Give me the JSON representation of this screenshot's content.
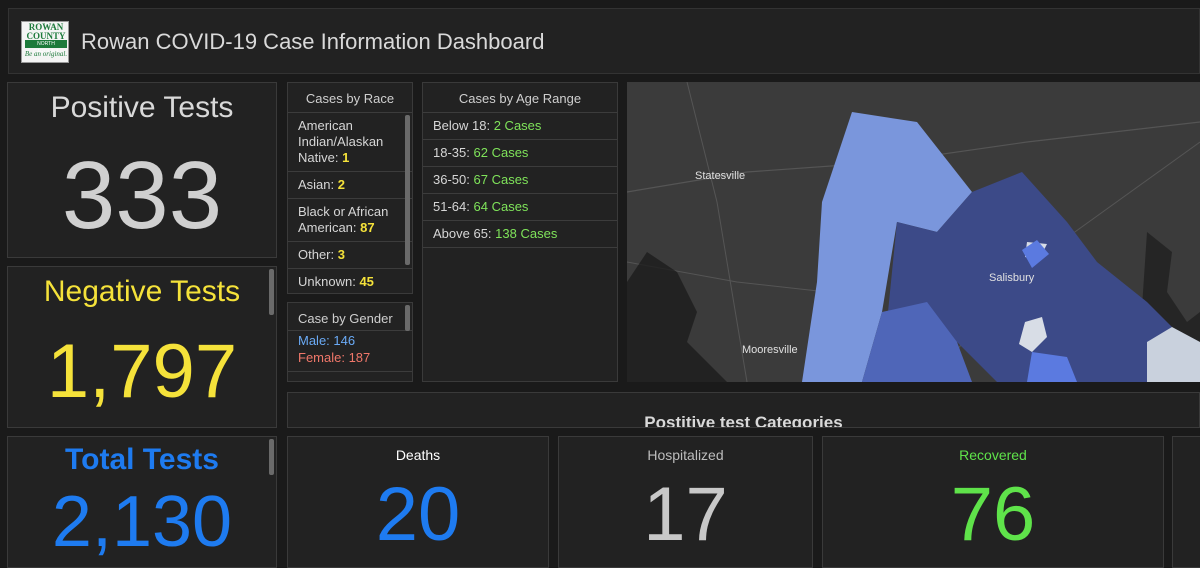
{
  "header": {
    "logo_top": "ROWAN COUNTY",
    "logo_mid": "NORTH CAROLINA",
    "logo_tagline": "Be an original.",
    "title": "Rowan COVID-19 Case Information Dashboard"
  },
  "positive": {
    "label": "Positive Tests",
    "value": "333"
  },
  "negative": {
    "label": "Negative Tests",
    "value": "1,797"
  },
  "total": {
    "label": "Total Tests",
    "value": "2,130"
  },
  "race": {
    "title": "Cases by Race",
    "items": [
      {
        "label": "American Indian/Alaskan Native:",
        "value": "1"
      },
      {
        "label": "Asian:",
        "value": "2"
      },
      {
        "label": "Black or African American:",
        "value": "87"
      },
      {
        "label": "Other:",
        "value": "3"
      },
      {
        "label": "Unknown:",
        "value": "45"
      }
    ]
  },
  "gender": {
    "title": "Case by Gender",
    "male": "Male: 146",
    "female": "Female: 187"
  },
  "age": {
    "title": "Cases by Age Range",
    "items": [
      {
        "label": "Below 18:",
        "value": "2 Cases"
      },
      {
        "label": "18-35:",
        "value": "62 Cases"
      },
      {
        "label": "36-50:",
        "value": "67 Cases"
      },
      {
        "label": "51-64:",
        "value": "64 Cases"
      },
      {
        "label": "Above 65:",
        "value": "138 Cases"
      }
    ]
  },
  "map": {
    "labels": {
      "statesville": "Statesville",
      "salisbury": "Salisbury",
      "mooresville": "Mooresville"
    }
  },
  "categories": {
    "title": "Postitive test Categories"
  },
  "cards": {
    "deaths": {
      "label": "Deaths",
      "value": "20"
    },
    "hospitalized": {
      "label": "Hospitalized",
      "value": "17"
    },
    "recovered": {
      "label": "Recovered",
      "value": "76"
    }
  },
  "colors": {
    "accent_yellow": "#f5e23a",
    "accent_blue": "#1e7bf0",
    "accent_green": "#5fe34a",
    "male_blue": "#6aaaf5",
    "female_red": "#f0776a"
  }
}
